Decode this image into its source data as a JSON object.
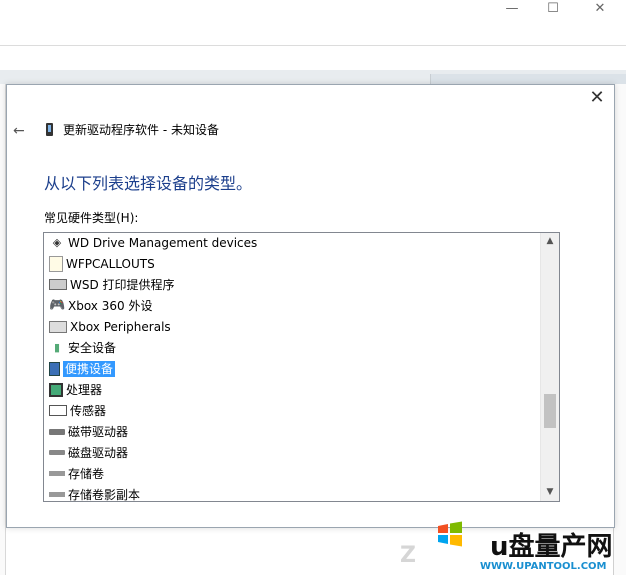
{
  "window": {
    "minimize_glyph": "—",
    "maximize_glyph": "☐",
    "close_glyph": "✕"
  },
  "dialog": {
    "close_glyph": "✕",
    "back_glyph": "←",
    "title": "更新驱动程序软件 - 未知设备",
    "heading": "从以下列表选择设备的类型。",
    "list_label": "常见硬件类型(H):"
  },
  "hardware_types": {
    "selected_index": 6,
    "items": [
      {
        "label": "WD Drive Management devices",
        "icon": "diamond-icon"
      },
      {
        "label": "WFPCALLOUTS",
        "icon": "document-icon"
      },
      {
        "label": "WSD 打印提供程序",
        "icon": "printer-icon"
      },
      {
        "label": "Xbox 360 外设",
        "icon": "gamepad-icon"
      },
      {
        "label": "Xbox Peripherals",
        "icon": "peripheral-icon"
      },
      {
        "label": "安全设备",
        "icon": "security-device-icon"
      },
      {
        "label": "便携设备",
        "icon": "portable-device-icon"
      },
      {
        "label": "处理器",
        "icon": "processor-icon"
      },
      {
        "label": "传感器",
        "icon": "sensor-icon"
      },
      {
        "label": "磁带驱动器",
        "icon": "tape-drive-icon"
      },
      {
        "label": "磁盘驱动器",
        "icon": "disk-drive-icon"
      },
      {
        "label": "存储卷",
        "icon": "storage-volume-icon"
      },
      {
        "label": "存储卷影副本",
        "icon": "shadow-copy-icon"
      }
    ]
  },
  "scrollbar": {
    "up_glyph": "▲",
    "down_glyph": "▼",
    "position_fraction": 0.72
  },
  "watermark": {
    "brand": "u盘量产网",
    "url": "WWW.UPANTOOL.COM"
  }
}
